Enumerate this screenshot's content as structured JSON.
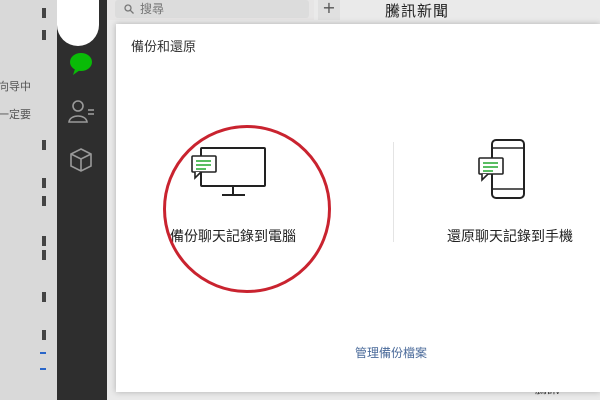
{
  "doc_strip": {
    "lines": [
      "向导中",
      "一定要"
    ]
  },
  "search": {
    "placeholder": "搜尋"
  },
  "chat_list": {
    "add_label": "+"
  },
  "chat_title": "騰訊新聞",
  "right_bottom_text": "騰訊",
  "dialog": {
    "title": "備份和還原",
    "backup_to_pc": "備份聊天記錄到電腦",
    "restore_to_phone": "還原聊天記錄到手機",
    "manage_link": "管理備份檔案"
  },
  "colors": {
    "sidebar_bg": "#2e2e2e",
    "wechat_green": "#09bb07",
    "annotation_red": "#c9232f",
    "link_blue": "#4a6a9a"
  }
}
